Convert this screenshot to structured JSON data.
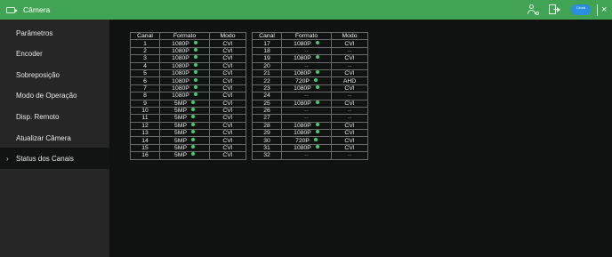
{
  "window": {
    "title": "Câmera",
    "cloud_badge": "Cloud"
  },
  "sidebar": {
    "items": [
      {
        "label": "Parâmetros"
      },
      {
        "label": "Encoder"
      },
      {
        "label": "Sobreposição"
      },
      {
        "label": "Modo de Operação"
      },
      {
        "label": "Disp. Remoto"
      },
      {
        "label": "Atualizar Câmera"
      },
      {
        "label": "Status dos Canais",
        "active": true
      }
    ]
  },
  "table": {
    "headers": [
      "Canal",
      "Formato",
      "Modo"
    ],
    "left": [
      {
        "canal": "1",
        "formato": "1080P",
        "online": true,
        "modo": "CVI"
      },
      {
        "canal": "2",
        "formato": "1080P",
        "online": true,
        "modo": "CVI"
      },
      {
        "canal": "3",
        "formato": "1080P",
        "online": true,
        "modo": "CVI"
      },
      {
        "canal": "4",
        "formato": "1080P",
        "online": true,
        "modo": "CVI"
      },
      {
        "canal": "5",
        "formato": "1080P",
        "online": true,
        "modo": "CVI"
      },
      {
        "canal": "6",
        "formato": "1080P",
        "online": true,
        "modo": "CVI"
      },
      {
        "canal": "7",
        "formato": "1080P",
        "online": true,
        "modo": "CVI"
      },
      {
        "canal": "8",
        "formato": "1080P",
        "online": true,
        "modo": "CVI"
      },
      {
        "canal": "9",
        "formato": "5MP",
        "online": true,
        "modo": "CVI"
      },
      {
        "canal": "10",
        "formato": "5MP",
        "online": true,
        "modo": "CVI"
      },
      {
        "canal": "11",
        "formato": "5MP",
        "online": true,
        "modo": "CVI"
      },
      {
        "canal": "12",
        "formato": "5MP",
        "online": true,
        "modo": "CVI"
      },
      {
        "canal": "13",
        "formato": "5MP",
        "online": true,
        "modo": "CVI"
      },
      {
        "canal": "14",
        "formato": "5MP",
        "online": true,
        "modo": "CVI"
      },
      {
        "canal": "15",
        "formato": "5MP",
        "online": true,
        "modo": "CVI"
      },
      {
        "canal": "16",
        "formato": "5MP",
        "online": true,
        "modo": "CVI"
      }
    ],
    "right": [
      {
        "canal": "17",
        "formato": "1080P",
        "online": true,
        "modo": "CVI"
      },
      {
        "canal": "18",
        "formato": "--",
        "online": false,
        "modo": "--"
      },
      {
        "canal": "19",
        "formato": "1080P",
        "online": true,
        "modo": "CVI"
      },
      {
        "canal": "20",
        "formato": "--",
        "online": false,
        "modo": "--"
      },
      {
        "canal": "21",
        "formato": "1080P",
        "online": true,
        "modo": "CVI"
      },
      {
        "canal": "22",
        "formato": "720P",
        "online": true,
        "modo": "AHD"
      },
      {
        "canal": "23",
        "formato": "1080P",
        "online": true,
        "modo": "CVI"
      },
      {
        "canal": "24",
        "formato": "--",
        "online": false,
        "modo": "--"
      },
      {
        "canal": "25",
        "formato": "1080P",
        "online": true,
        "modo": "CVI"
      },
      {
        "canal": "26",
        "formato": "--",
        "online": false,
        "modo": "--"
      },
      {
        "canal": "27",
        "formato": "--",
        "online": false,
        "modo": "--"
      },
      {
        "canal": "28",
        "formato": "1080P",
        "online": true,
        "modo": "CVI"
      },
      {
        "canal": "29",
        "formato": "1080P",
        "online": true,
        "modo": "CVI"
      },
      {
        "canal": "30",
        "formato": "720P",
        "online": true,
        "modo": "CVI"
      },
      {
        "canal": "31",
        "formato": "1080P",
        "online": true,
        "modo": "CVI"
      },
      {
        "canal": "32",
        "formato": "--",
        "online": false,
        "modo": "--"
      }
    ]
  },
  "colors": {
    "titlebar": "#41a455",
    "sidebar": "#262626",
    "content": "#0f1211",
    "status_dot": "#3fcf6e"
  },
  "icons": {
    "app": "camera-icon",
    "user": "users-icon",
    "exit": "logout-icon",
    "cloud": "cloud-icon",
    "close": "close-icon"
  }
}
